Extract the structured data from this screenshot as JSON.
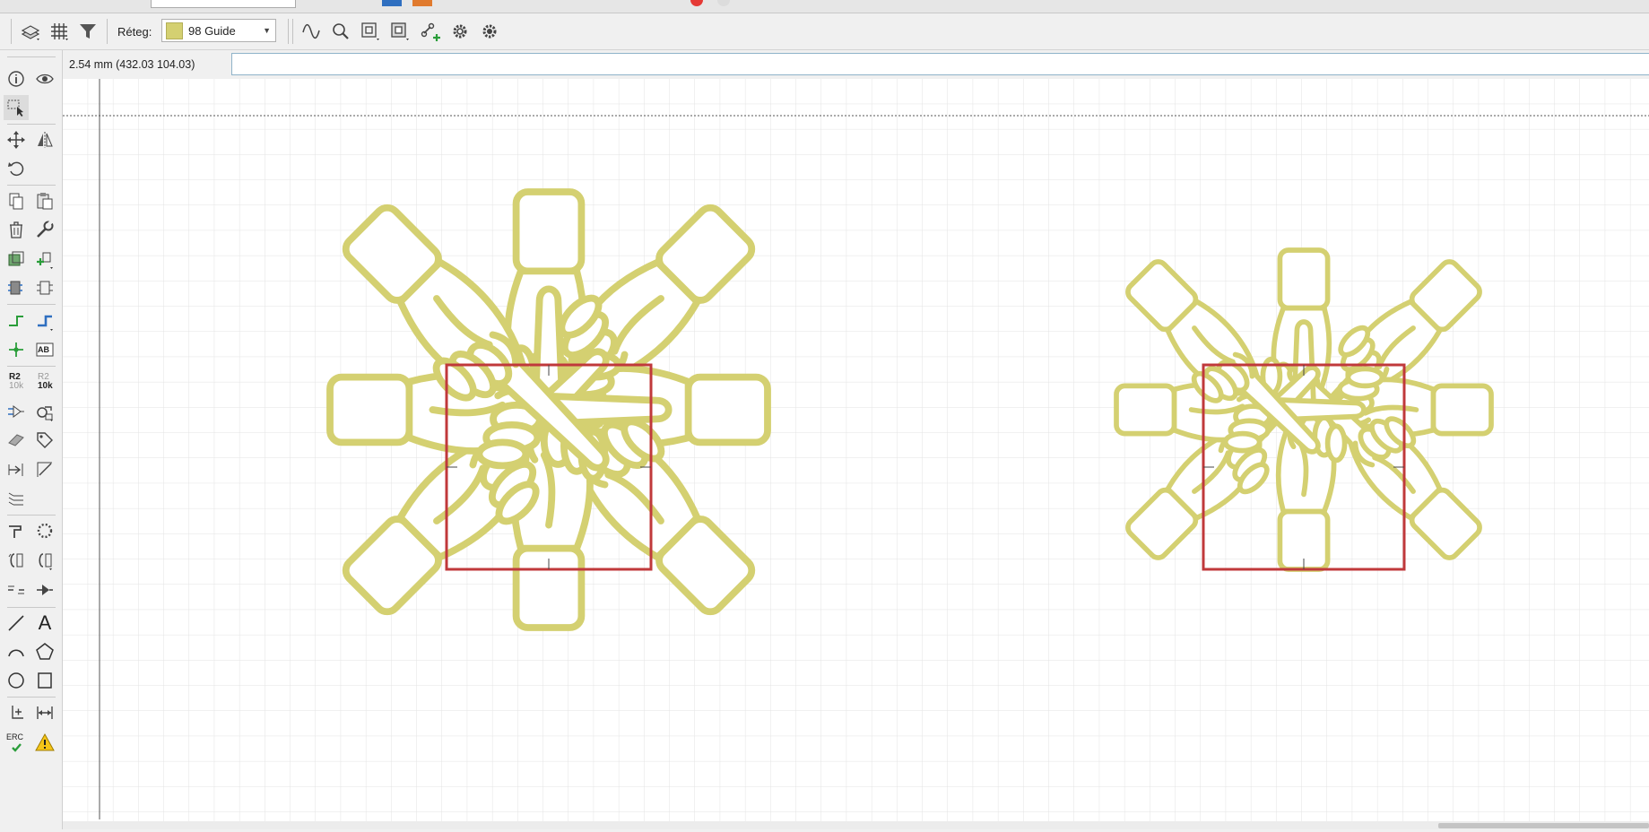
{
  "toolbar": {
    "layer_label": "Réteg:",
    "layer_value": "98 Guide",
    "layer_color": "#d4d071"
  },
  "status": {
    "coordinate_readout": "2.54 mm (432.03 104.03)",
    "command_value": ""
  },
  "left_toolbar": {
    "component_ref": "R2",
    "component_value": "10k",
    "text_label": "AB",
    "erc_label": "ERC",
    "text_tool_glyph": "A"
  },
  "canvas": {
    "background": "#ffffff",
    "grid_color": "#e3e3e3",
    "guide_color": "#d4d071",
    "box_color": "#c0393b",
    "cursor_color": "#333333"
  },
  "icons": [
    "layers-icon",
    "grid-icon",
    "filter-icon",
    "sine-wave-icon",
    "zoom-icon",
    "display-options-icon",
    "display-options-2-icon",
    "add-link-icon",
    "gear-icon",
    "gear-2-icon",
    "info-icon",
    "eye-icon",
    "select-icon",
    "move-icon",
    "mirror-icon",
    "rotate-icon",
    "copy-icon",
    "paste-icon",
    "delete-icon",
    "wrench-icon",
    "warning-icon"
  ]
}
